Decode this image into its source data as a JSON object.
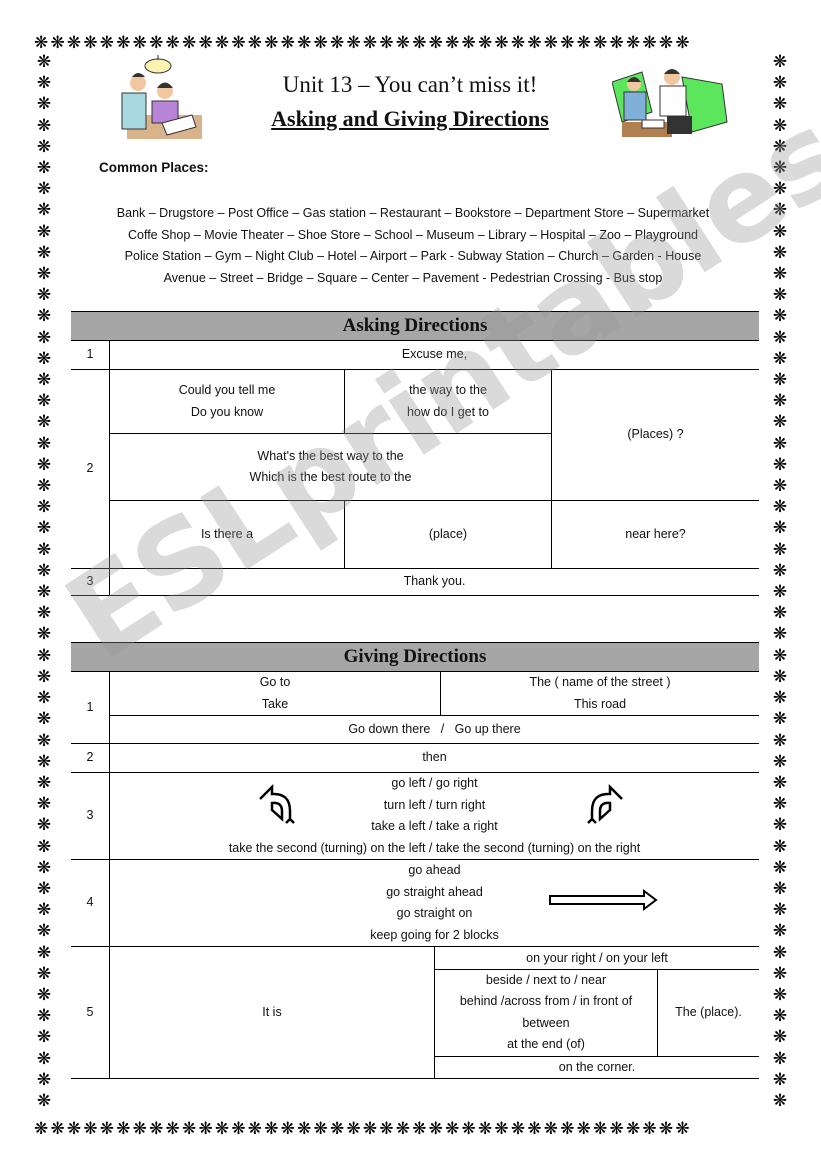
{
  "border": {
    "glyph": "❋"
  },
  "header": {
    "title": "Unit 13 – You can’t miss it!",
    "subtitle": "Asking and Giving Directions",
    "left_image": "students-studying-clipart",
    "right_image": "tutor-and-student-clipart"
  },
  "common_places": {
    "label": "Common Places:",
    "lines": [
      "Bank – Drugstore – Post Office – Gas station – Restaurant – Bookstore – Department Store – Supermarket",
      "Coffe Shop – Movie Theater – Shoe Store – School – Museum – Library – Hospital – Zoo – Playground",
      "Police Station – Gym – Night Club – Hotel – Airport – Park - Subway Station – Church – Garden - House",
      "Avenue – Street – Bridge – Square – Center – Pavement - Pedestrian Crossing  - Bus stop"
    ]
  },
  "watermark": "ESLprintables.com",
  "asking": {
    "title": "Asking Directions",
    "row1": {
      "num": "1",
      "text": "Excuse me,"
    },
    "row2": {
      "num": "2",
      "a1": [
        "Could you tell me",
        "Do you know"
      ],
      "a2": [
        "the way to the",
        "how do I get to"
      ],
      "a3": "(Places) ?",
      "b1": [
        "What's the best way to the",
        "Which is the best route to the"
      ],
      "c1": "Is there a",
      "c2": "(place)",
      "c3": "near here?"
    },
    "row3": {
      "num": "3",
      "text": "Thank you."
    }
  },
  "giving": {
    "title": "Giving Directions",
    "row1": {
      "num": "1",
      "a1": [
        "Go to",
        "Take"
      ],
      "a2": [
        "The ( name of the street )",
        "This road"
      ],
      "b": "Go down there   /   Go up there"
    },
    "row2": {
      "num": "2",
      "text": "then"
    },
    "row3": {
      "num": "3",
      "lines": [
        "go left  / go right",
        "turn left / turn right",
        "take a left  /  take a right",
        "take the second (turning) on the left  / take the second (turning) on the right"
      ],
      "left_icon": "turn-left-arrow",
      "right_icon": "turn-right-arrow"
    },
    "row4": {
      "num": "4",
      "lines": [
        "go ahead",
        "go straight ahead",
        "go straight on",
        "keep going for 2 blocks"
      ],
      "icon": "straight-arrow"
    },
    "row5": {
      "num": "5",
      "it_is": "It is",
      "top": "on your right  /  on your left",
      "mid": [
        "beside  / next to / near",
        "behind /across from  / in front of",
        "between",
        "at the end (of)"
      ],
      "place": "The (place).",
      "bottom": "on the corner."
    }
  }
}
